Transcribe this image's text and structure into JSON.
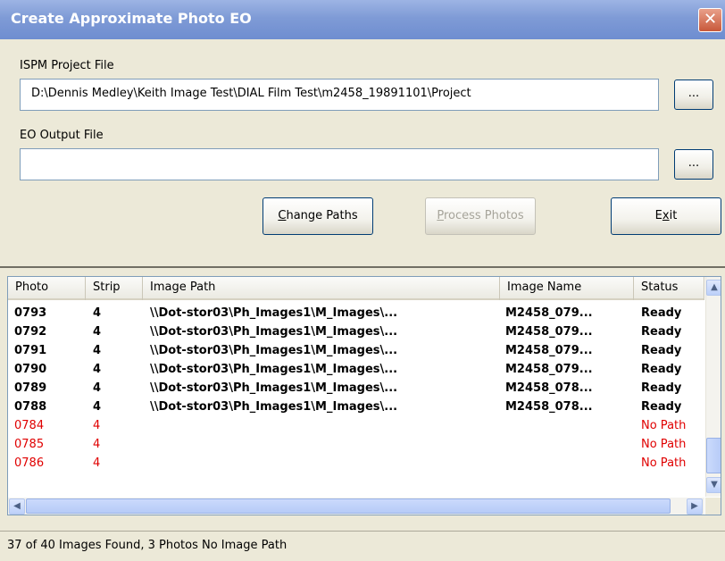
{
  "window": {
    "title": "Create Approximate Photo EO",
    "close_glyph": "✕"
  },
  "form": {
    "project_label": "ISPM Project File",
    "project_value": "D:\\Dennis Medley\\Keith Image Test\\DIAL Film Test\\m2458_19891101\\Project",
    "eo_label": "EO Output File",
    "eo_value": "",
    "browse_label": "...",
    "buttons": {
      "change_paths_pre": "",
      "change_paths_key": "C",
      "change_paths_post": "hange Paths",
      "process_photos_pre": "",
      "process_photos_key": "P",
      "process_photos_post": "rocess Photos",
      "exit_pre": "E",
      "exit_key": "x",
      "exit_post": "it"
    }
  },
  "table": {
    "columns": [
      "Photo",
      "Strip",
      "Image Path",
      "Image Name",
      "Status"
    ],
    "rows": [
      {
        "photo": "0793",
        "strip": "4",
        "path": "\\\\Dot-stor03\\Ph_Images1\\M_Images\\...",
        "name": "M2458_079...",
        "status": "Ready",
        "kind": "ready"
      },
      {
        "photo": "0792",
        "strip": "4",
        "path": "\\\\Dot-stor03\\Ph_Images1\\M_Images\\...",
        "name": "M2458_079...",
        "status": "Ready",
        "kind": "ready"
      },
      {
        "photo": "0791",
        "strip": "4",
        "path": "\\\\Dot-stor03\\Ph_Images1\\M_Images\\...",
        "name": "M2458_079...",
        "status": "Ready",
        "kind": "ready"
      },
      {
        "photo": "0790",
        "strip": "4",
        "path": "\\\\Dot-stor03\\Ph_Images1\\M_Images\\...",
        "name": "M2458_079...",
        "status": "Ready",
        "kind": "ready"
      },
      {
        "photo": "0789",
        "strip": "4",
        "path": "\\\\Dot-stor03\\Ph_Images1\\M_Images\\...",
        "name": "M2458_078...",
        "status": "Ready",
        "kind": "ready"
      },
      {
        "photo": "0788",
        "strip": "4",
        "path": "\\\\Dot-stor03\\Ph_Images1\\M_Images\\...",
        "name": "M2458_078...",
        "status": "Ready",
        "kind": "ready"
      },
      {
        "photo": "0784",
        "strip": "4",
        "path": "",
        "name": "",
        "status": "No Path",
        "kind": "nopath"
      },
      {
        "photo": "0785",
        "strip": "4",
        "path": "",
        "name": "",
        "status": "No Path",
        "kind": "nopath"
      },
      {
        "photo": "0786",
        "strip": "4",
        "path": "",
        "name": "",
        "status": "No Path",
        "kind": "nopath"
      }
    ]
  },
  "status_bar": {
    "text": "37 of 40 Images Found, 3 Photos No Image Path"
  },
  "colors": {
    "ready_text": "#000000",
    "no_path_text": "#e00000",
    "title_bar": "#7f9bd6"
  },
  "icons": {
    "scroll_up": "▲",
    "scroll_down": "▼",
    "scroll_left": "◀",
    "scroll_right": "▶"
  }
}
